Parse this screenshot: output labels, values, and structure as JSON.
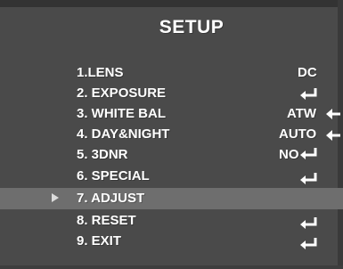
{
  "screen": {
    "title": "SETUP",
    "menu_items": [
      {
        "label": "1.LENS",
        "value": "DC",
        "value_icon": ""
      },
      {
        "label": "2. EXPOSURE",
        "value": "",
        "value_icon": "enter-icon"
      },
      {
        "label": "3. WHITE BAL",
        "value": "ATW",
        "value_icon": "left-arrow-icon"
      },
      {
        "label": "4. DAY&NIGHT",
        "value": "AUTO",
        "value_icon": "left-arrow-icon"
      },
      {
        "label": "5. 3DNR",
        "value": "NO",
        "value_icon": "enter-icon"
      },
      {
        "label": "6. SPECIAL",
        "value": "",
        "value_icon": "enter-icon"
      },
      {
        "label": "7. ADJUST",
        "value": "",
        "value_icon": "",
        "selected": true
      },
      {
        "label": "8. RESET",
        "value": "",
        "value_icon": "enter-icon"
      },
      {
        "label": "9. EXIT",
        "value": "",
        "value_icon": "enter-icon"
      }
    ],
    "colors": {
      "background": "#4a4a4a",
      "highlight": "#6e6e6e",
      "text": "#ffffff"
    }
  }
}
